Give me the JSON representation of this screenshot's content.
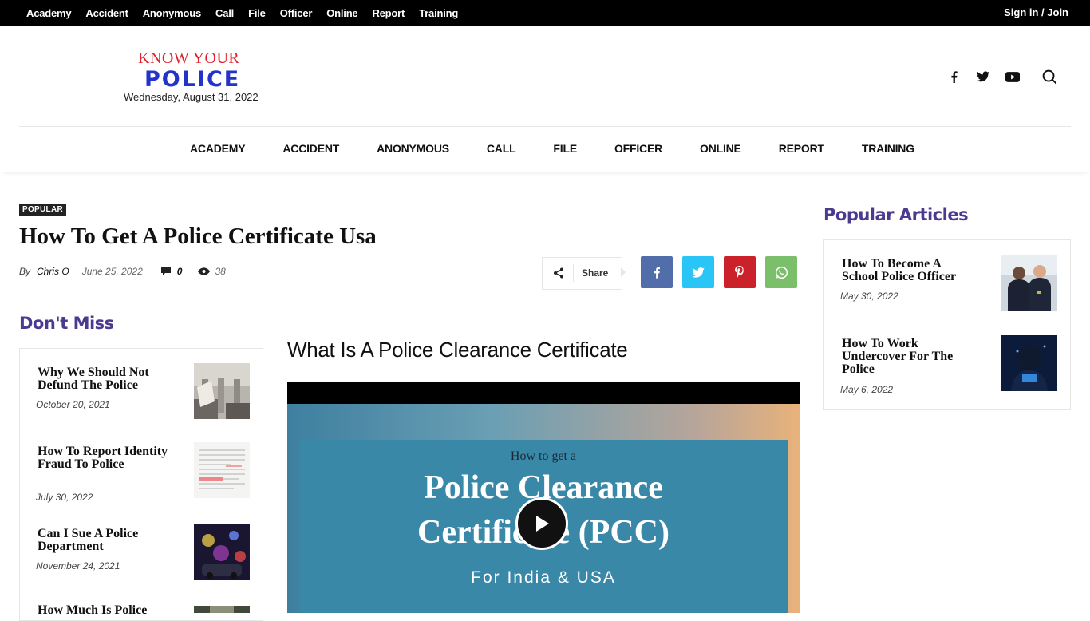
{
  "topbar": {
    "links": [
      "Academy",
      "Accident",
      "Anonymous",
      "Call",
      "File",
      "Officer",
      "Online",
      "Report",
      "Training"
    ],
    "signin": "Sign in / Join"
  },
  "logo": {
    "line1": "KNOW YOUR",
    "line2": "POLICE",
    "date": "Wednesday, August 31, 2022"
  },
  "social_icons": [
    "facebook-icon",
    "twitter-icon",
    "youtube-icon",
    "search-icon"
  ],
  "mainnav": [
    "ACADEMY",
    "ACCIDENT",
    "ANONYMOUS",
    "CALL",
    "FILE",
    "OFFICER",
    "ONLINE",
    "REPORT",
    "TRAINING"
  ],
  "article": {
    "category": "POPULAR",
    "title": "How To Get A Police Certificate Usa",
    "by": "By",
    "author": "Chris O",
    "date": "June 25, 2022",
    "comments": "0",
    "views": "38",
    "share_label": "Share",
    "subheading": "What Is A Police Clearance Certificate"
  },
  "share_buttons": [
    {
      "name": "facebook",
      "color": "#516eab"
    },
    {
      "name": "twitter",
      "color": "#29c5f6"
    },
    {
      "name": "pinterest",
      "color": "#ca212a"
    },
    {
      "name": "whatsapp",
      "color": "#7bbf6a"
    }
  ],
  "dont_miss": {
    "heading": "Don't Miss",
    "items": [
      {
        "title": "Why We Should Not Defund The Police",
        "date": "October 20, 2021"
      },
      {
        "title": "How To Report Identity Fraud To Police",
        "date": "July 30, 2022"
      },
      {
        "title": "Can I Sue A Police Department",
        "date": "November 24, 2021"
      },
      {
        "title": "How Much Is Police",
        "date": ""
      }
    ]
  },
  "popular": {
    "heading": "Popular Articles",
    "items": [
      {
        "title": "How To Become A School Police Officer",
        "date": "May 30, 2022"
      },
      {
        "title": "How To Work Undercover For The Police",
        "date": "May 6, 2022"
      }
    ]
  },
  "video": {
    "line1": "How to get a",
    "line2": "Police Clearance",
    "line3": "Certificate (PCC)",
    "line4": "For India & USA"
  }
}
